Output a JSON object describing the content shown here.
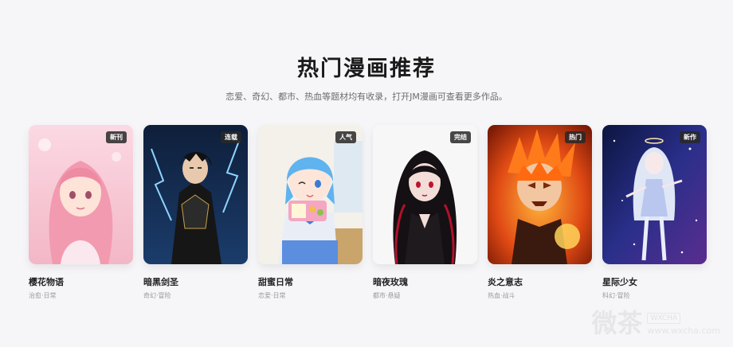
{
  "section": {
    "title": "热门漫画推荐",
    "subtitle": "恋爱、奇幻、都市、热血等题材均有收录，打开JM漫画可查看更多作品。"
  },
  "cards": [
    {
      "name": "樱花物语",
      "tags": "治愈·日常",
      "badge": "新刊"
    },
    {
      "name": "暗黑剑圣",
      "tags": "奇幻·冒险",
      "badge": "连载"
    },
    {
      "name": "甜蜜日常",
      "tags": "恋爱·日常",
      "badge": "人气"
    },
    {
      "name": "暗夜玫瑰",
      "tags": "都市·悬疑",
      "badge": "完结"
    },
    {
      "name": "炎之意志",
      "tags": "热血·战斗",
      "badge": "热门"
    },
    {
      "name": "星际少女",
      "tags": "科幻·冒险",
      "badge": "新作"
    }
  ],
  "watermark": {
    "big": "微茶",
    "en": "WXCHA",
    "url": "www.wxcha.com"
  }
}
